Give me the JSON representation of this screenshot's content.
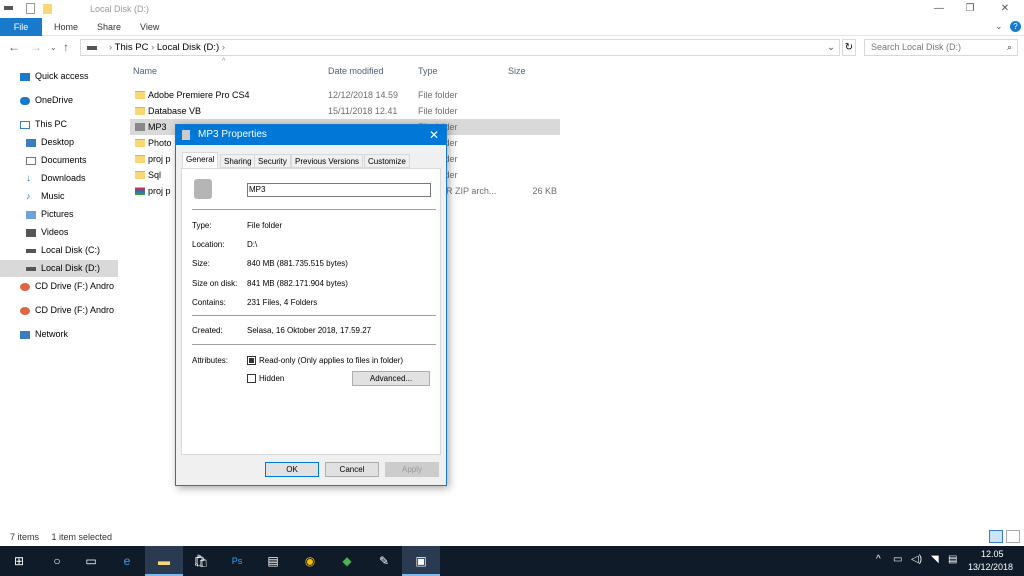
{
  "window": {
    "title": "Local Disk (D:)",
    "controls": [
      "—",
      "❐",
      "✕"
    ]
  },
  "ribbon": {
    "tabs": [
      "File",
      "Home",
      "Share",
      "View"
    ]
  },
  "address": {
    "crumbs": [
      "This PC",
      "Local Disk (D:)"
    ],
    "search_placeholder": "Search Local Disk (D:)"
  },
  "sidebar": {
    "items": [
      {
        "label": "Quick access",
        "icon": "star-icon"
      },
      {
        "label": "OneDrive",
        "icon": "cloud-icon"
      },
      {
        "label": "This PC",
        "icon": "computer-icon"
      },
      {
        "label": "Desktop",
        "icon": "desktop-icon"
      },
      {
        "label": "Documents",
        "icon": "documents-icon"
      },
      {
        "label": "Downloads",
        "icon": "download-icon"
      },
      {
        "label": "Music",
        "icon": "music-icon"
      },
      {
        "label": "Pictures",
        "icon": "pictures-icon"
      },
      {
        "label": "Videos",
        "icon": "videos-icon"
      },
      {
        "label": "Local Disk (C:)",
        "icon": "drive-icon"
      },
      {
        "label": "Local Disk (D:)",
        "icon": "drive-icon"
      },
      {
        "label": "CD Drive (F:) Andro",
        "icon": "cd-icon"
      },
      {
        "label": "CD Drive (F:) Andro",
        "icon": "cd-icon"
      },
      {
        "label": "Network",
        "icon": "network-icon"
      }
    ]
  },
  "columns": [
    "Name",
    "Date modified",
    "Type",
    "Size"
  ],
  "files": [
    {
      "name": "Adobe Premiere Pro CS4",
      "date": "12/12/2018 14.59",
      "type": "File folder",
      "size": ""
    },
    {
      "name": "Database VB",
      "date": "15/11/2018 12.41",
      "type": "File folder",
      "size": ""
    },
    {
      "name": "MP3",
      "date": "",
      "type": "File folder",
      "size": ""
    },
    {
      "name": "Photo",
      "date": "",
      "type": "File folder",
      "size": ""
    },
    {
      "name": "proj p",
      "date": "",
      "type": "File folder",
      "size": ""
    },
    {
      "name": "Sql",
      "date": "",
      "type": "File folder",
      "size": ""
    },
    {
      "name": "proj p",
      "date": "",
      "type": "WinRAR ZIP arch...",
      "size": "26 KB"
    }
  ],
  "dialog": {
    "title": "MP3 Properties",
    "tabs": [
      "General",
      "Sharing",
      "Security",
      "Previous Versions",
      "Customize"
    ],
    "name": "MP3",
    "props": [
      {
        "k": "Type:",
        "v": "File folder"
      },
      {
        "k": "Location:",
        "v": "D:\\"
      },
      {
        "k": "Size:",
        "v": "840 MB (881.735.515 bytes)"
      },
      {
        "k": "Size on disk:",
        "v": "841 MB (882.171.904 bytes)"
      },
      {
        "k": "Contains:",
        "v": "231 Files, 4 Folders"
      }
    ],
    "created_label": "Created:",
    "created": "Selasa, 16 Oktober 2018, 17.59.27",
    "attributes_label": "Attributes:",
    "readonly": "Read-only (Only applies to files in folder)",
    "hidden": "Hidden",
    "advanced": "Advanced...",
    "ok": "OK",
    "cancel": "Cancel",
    "apply": "Apply"
  },
  "status": {
    "items": "7 items",
    "selected": "1 item selected"
  },
  "tray": {
    "time": "12.05",
    "date": "13/12/2018"
  }
}
